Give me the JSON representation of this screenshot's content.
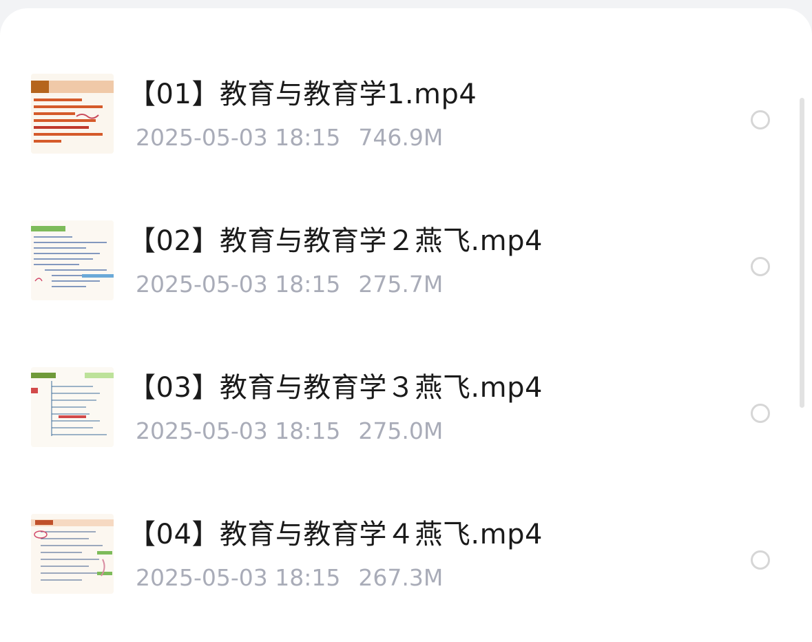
{
  "files": [
    {
      "name": "【01】教育与教育学1.mp4",
      "date": "2025-05-03 18:15",
      "size": "746.9M",
      "thumb_icon": "slide-thumbnail-icon"
    },
    {
      "name": "【02】教育与教育学２燕飞.mp4",
      "date": "2025-05-03 18:15",
      "size": "275.7M",
      "thumb_icon": "mindmap-thumbnail-icon"
    },
    {
      "name": "【03】教育与教育学３燕飞.mp4",
      "date": "2025-05-03 18:15",
      "size": "275.0M",
      "thumb_icon": "mindmap-thumbnail-icon"
    },
    {
      "name": "【04】教育与教育学４燕飞.mp4",
      "date": "2025-05-03 18:15",
      "size": "267.3M",
      "thumb_icon": "mindmap-thumbnail-icon"
    }
  ],
  "colors": {
    "title": "#1a1a1a",
    "meta": "#a9acb8",
    "radio_border": "#d6d6d6",
    "background": "#f2f3f5",
    "thumb_accent": "#e8743b"
  }
}
